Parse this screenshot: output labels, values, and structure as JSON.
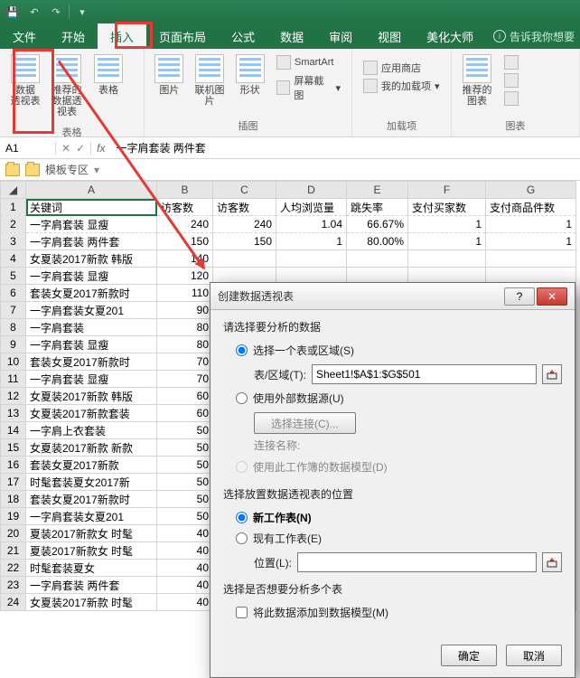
{
  "tabs": {
    "file": "文件",
    "home": "开始",
    "insert": "插入",
    "layout": "页面布局",
    "formula": "公式",
    "data": "数据",
    "review": "审阅",
    "view": "视图",
    "beautify": "美化大师",
    "tell": "告诉我你想要"
  },
  "ribbon": {
    "pivot": "数据\n透视表",
    "recpivot": "推荐的\n数据透视表",
    "table": "表格",
    "group_tables": "表格",
    "pic": "图片",
    "online_pic": "联机图片",
    "shapes": "形状",
    "smartart": "SmartArt",
    "screenshot": "屏幕截图",
    "group_illus": "插图",
    "store": "应用商店",
    "myaddins": "我的加载项",
    "group_addins": "加载项",
    "recchart": "推荐的\n图表",
    "group_charts": "图表"
  },
  "namebox": "A1",
  "formula_value": "一字肩套装 两件套",
  "toolbar2": {
    "template": "模板专区"
  },
  "columns": [
    "A",
    "B",
    "C",
    "D",
    "E",
    "F",
    "G"
  ],
  "headers": [
    "关键词",
    "访客数",
    "访客数",
    "人均浏览量",
    "跳失率",
    "支付买家数",
    "支付商品件数"
  ],
  "rows": [
    {
      "r": 2,
      "a": "一字肩套装 显瘦",
      "b": "240",
      "c": "240",
      "d": "1.04",
      "e": "66.67%",
      "f": "1",
      "g": "1"
    },
    {
      "r": 3,
      "a": "一字肩套装 两件套",
      "b": "150",
      "c": "150",
      "d": "1",
      "e": "80.00%",
      "f": "1",
      "g": "1"
    },
    {
      "r": 4,
      "a": "女夏装2017新款 韩版",
      "b": "140"
    },
    {
      "r": 5,
      "a": "一字肩套装 显瘦",
      "b": "120"
    },
    {
      "r": 6,
      "a": "套装女夏2017新款时",
      "b": "110"
    },
    {
      "r": 7,
      "a": "一字肩套装女夏201",
      "b": "90"
    },
    {
      "r": 8,
      "a": "一字肩套装",
      "b": "80"
    },
    {
      "r": 9,
      "a": "一字肩套装 显瘦",
      "b": "80"
    },
    {
      "r": 10,
      "a": "套装女夏2017新款时",
      "b": "70"
    },
    {
      "r": 11,
      "a": "一字肩套装 显瘦",
      "b": "70"
    },
    {
      "r": 12,
      "a": "女夏装2017新款 韩版",
      "b": "60"
    },
    {
      "r": 13,
      "a": "女夏装2017新款套装",
      "b": "60"
    },
    {
      "r": 14,
      "a": "一字肩上衣套装",
      "b": "50"
    },
    {
      "r": 15,
      "a": "女夏装2017新款 新款",
      "b": "50"
    },
    {
      "r": 16,
      "a": "套装女夏2017新款",
      "b": "50"
    },
    {
      "r": 17,
      "a": "时髦套装夏女2017新",
      "b": "50"
    },
    {
      "r": 18,
      "a": "套装女夏2017新款时",
      "b": "50"
    },
    {
      "r": 19,
      "a": "一字肩套装女夏201",
      "b": "50"
    },
    {
      "r": 20,
      "a": "夏装2017新款女 时髦",
      "b": "40"
    },
    {
      "r": 21,
      "a": "夏装2017新款女 时髦",
      "b": "40"
    },
    {
      "r": 22,
      "a": "时髦套装夏女",
      "b": "40"
    },
    {
      "r": 23,
      "a": "一字肩套装 两件套",
      "b": "40"
    },
    {
      "r": 24,
      "a": "女夏装2017新款 时髦",
      "b": "40"
    }
  ],
  "dialog": {
    "title": "创建数据透视表",
    "sec1": "请选择要分析的数据",
    "opt_range": "选择一个表或区域(S)",
    "range_label": "表/区域(T):",
    "range_value": "Sheet1!$A$1:$G$501",
    "opt_external": "使用外部数据源(U)",
    "btn_conn": "选择连接(C)...",
    "conn_name": "连接名称:",
    "opt_model": "使用此工作簿的数据模型(D)",
    "sec2": "选择放置数据透视表的位置",
    "opt_newsheet": "新工作表(N)",
    "opt_existing": "现有工作表(E)",
    "loc_label": "位置(L):",
    "sec3": "选择是否想要分析多个表",
    "chk_addmodel": "将此数据添加到数据模型(M)",
    "ok": "确定",
    "cancel": "取消"
  }
}
